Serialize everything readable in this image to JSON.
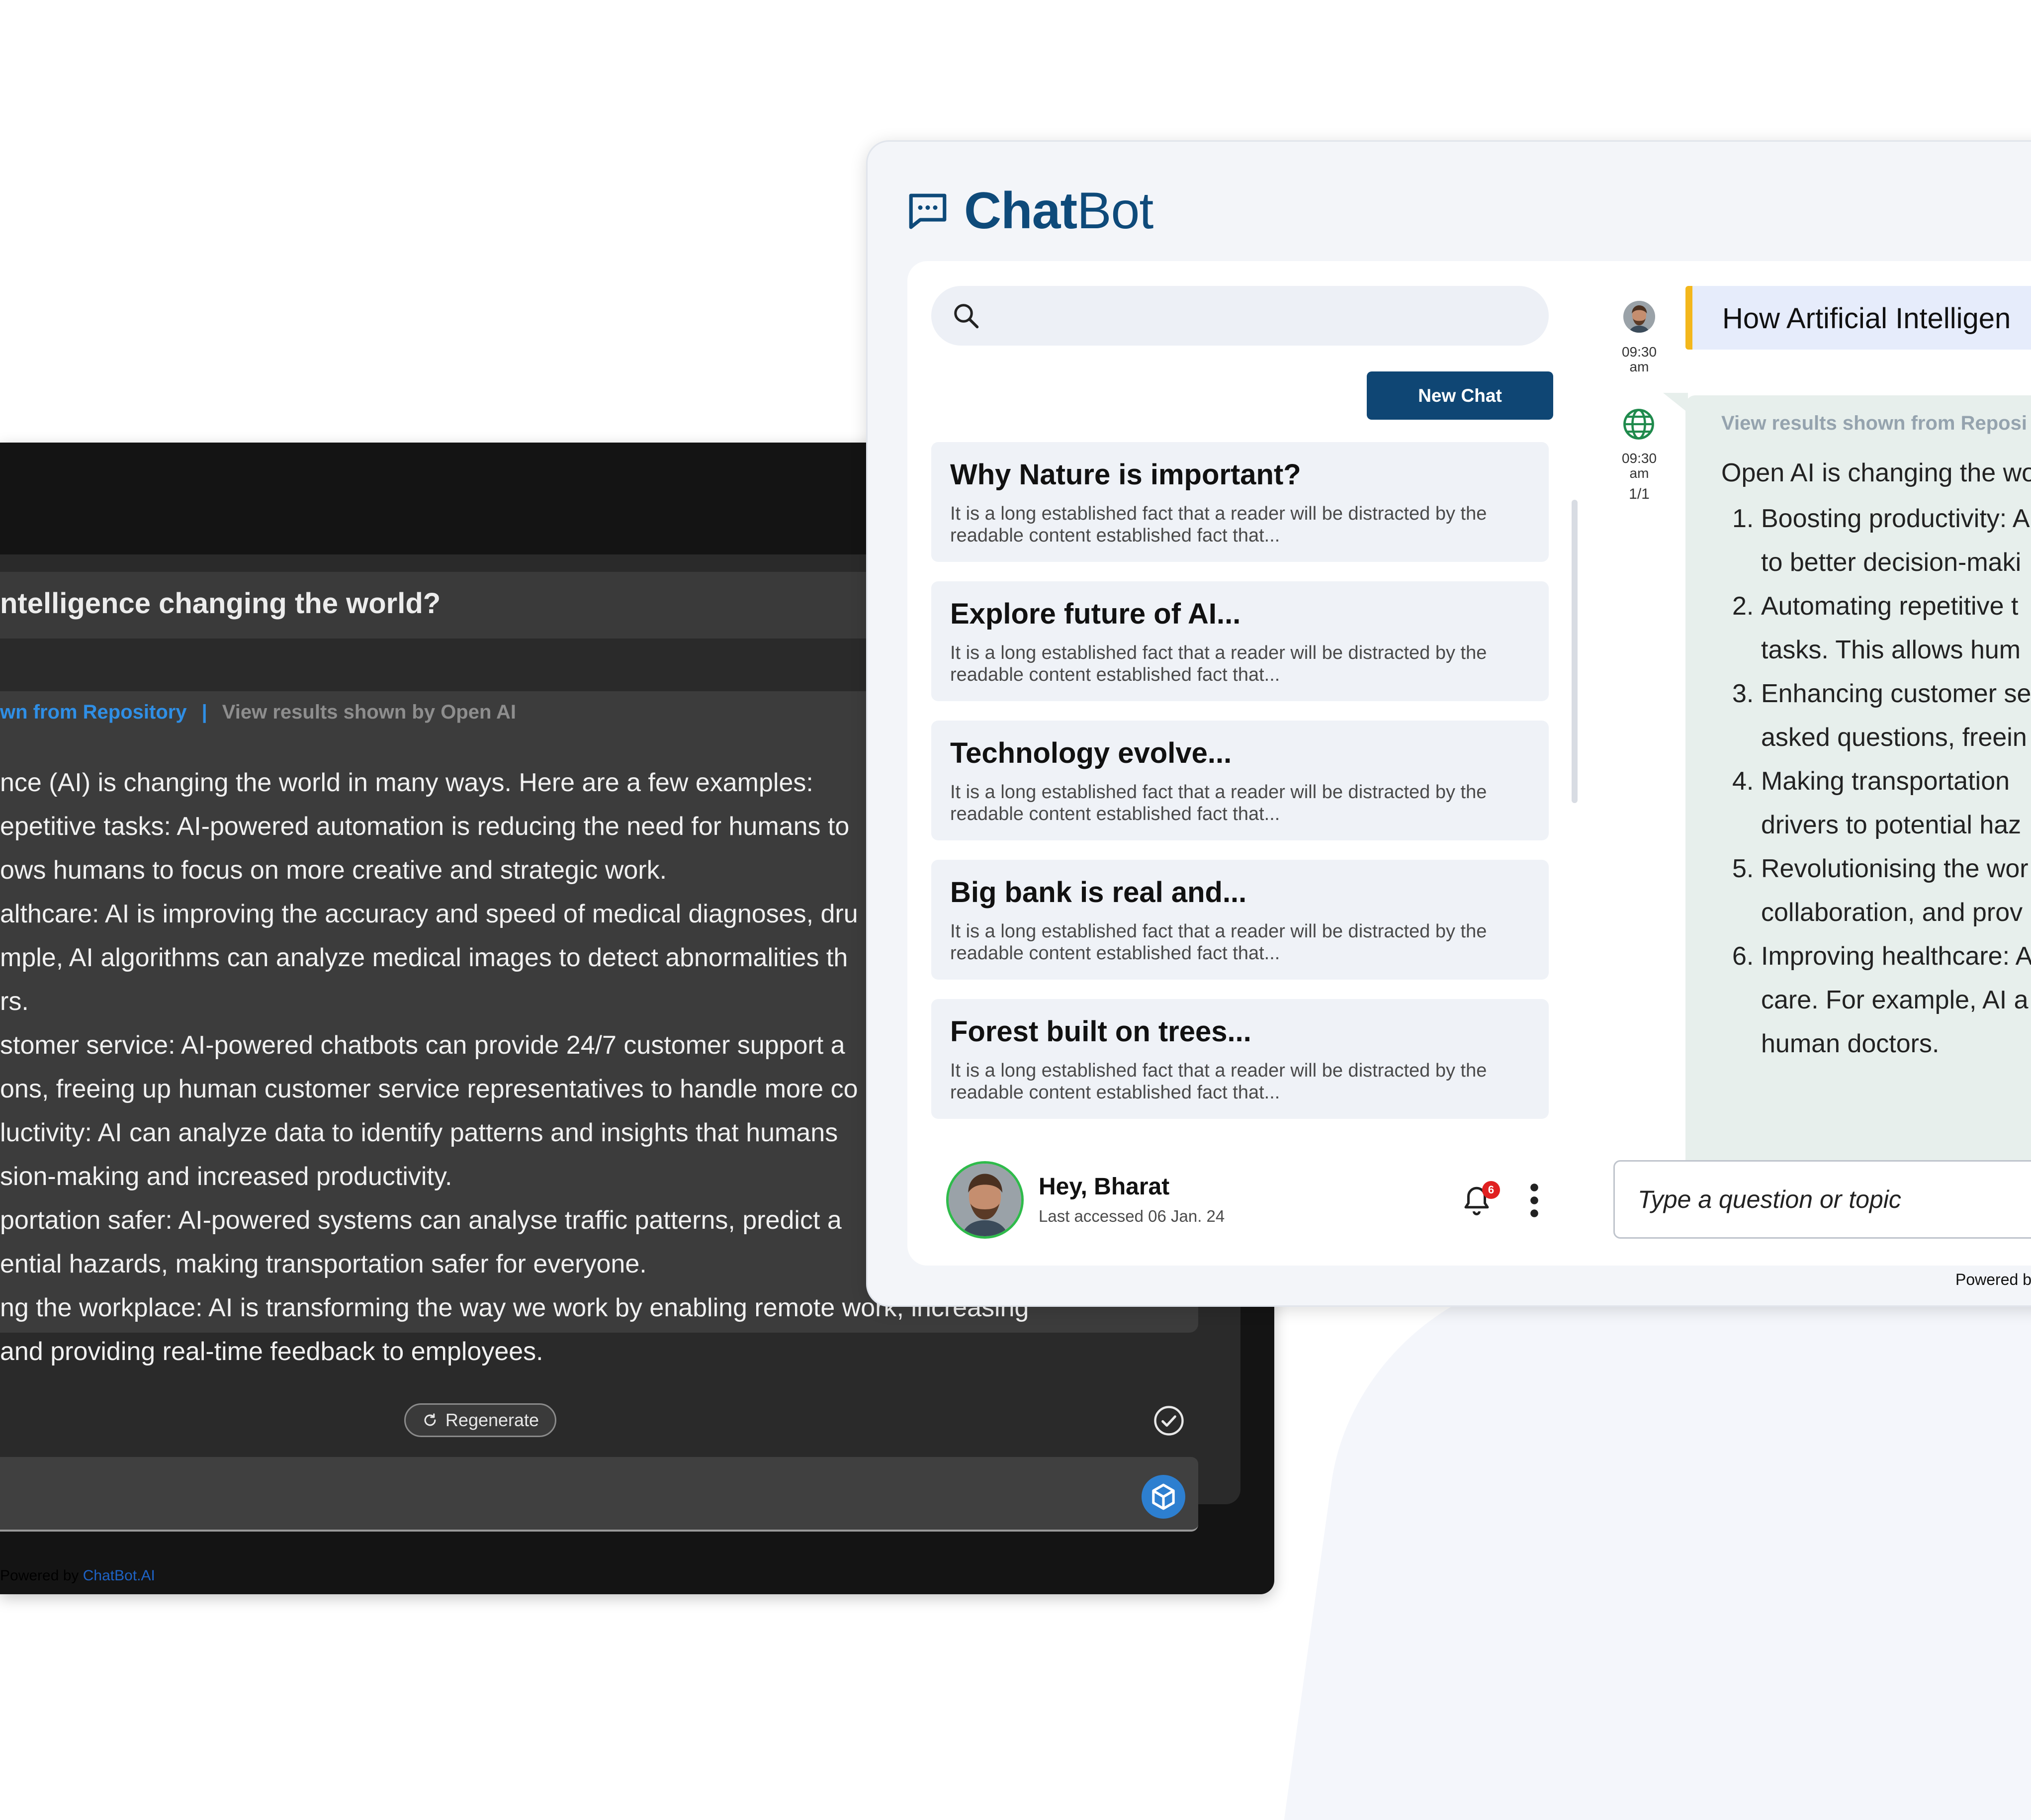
{
  "dark_window": {
    "question": "ntelligence changing the world?",
    "link_repository": "wn from Repository",
    "link_separator": "|",
    "link_openai": "View results shown by Open AI",
    "answer_lines": [
      "nce (AI) is changing the world in many ways. Here are a few examples:",
      "epetitive tasks: AI-powered automation is reducing the need for humans to",
      "ows humans to focus on more creative and strategic work.",
      "althcare: AI is improving the accuracy and speed of medical diagnoses, dru",
      "mple, AI algorithms can analyze medical images to detect abnormalities th",
      "rs.",
      "stomer service: AI-powered chatbots can provide 24/7 customer support a",
      "ons, freeing up human customer service representatives to handle more co",
      "luctivity: AI can analyze data to identify patterns and insights that humans",
      "sion-making and increased productivity.",
      "portation safer: AI-powered systems can analyse traffic patterns, predict a",
      "ential hazards, making transportation safer for everyone.",
      "ng the workplace: AI is transforming the way we work by enabling remote work, increasing",
      " and providing real-time feedback to employees."
    ],
    "regenerate_label": "Regenerate",
    "footer_prefix": "Powered by ",
    "footer_brand": "ChatBot.AI"
  },
  "light_window": {
    "brand_bold": "Chat",
    "brand_rest": "Bot",
    "search_placeholder": "",
    "new_chat_label": "New Chat",
    "chats": [
      {
        "title": "Why Nature is important?",
        "desc": "It is a long established fact that a reader will be distracted by the readable content established fact that..."
      },
      {
        "title": "Explore future of AI...",
        "desc": "It is a long established fact that a reader will be distracted by the readable content established fact that..."
      },
      {
        "title": "Technology evolve...",
        "desc": "It is a long established fact that a reader will be distracted by the readable content established fact that..."
      },
      {
        "title": "Big bank is real and...",
        "desc": "It is a long established fact that a reader will be distracted by the readable content established fact that..."
      },
      {
        "title": "Forest built on trees...",
        "desc": "It is a long established fact that a reader will be distracted by the readable content established fact that..."
      }
    ],
    "user": {
      "greeting": "Hey, Bharat",
      "last_accessed": "Last accessed 06 Jan. 24",
      "notification_count": "6"
    },
    "messages": {
      "user_time": "09:30",
      "user_ampm": "am",
      "bot_time": "09:30",
      "bot_ampm": "am",
      "bot_page": "1/1",
      "question": "How Artificial Intelligen",
      "repo_link": "View results shown from Reposi",
      "intro": "Open AI is changing the wo",
      "items": [
        {
          "num": "1.",
          "lines": [
            "Boosting productivity: A",
            "to better decision-maki"
          ]
        },
        {
          "num": "2.",
          "lines": [
            "Automating repetitive t",
            "tasks. This allows hum"
          ]
        },
        {
          "num": "3.",
          "lines": [
            "Enhancing customer se",
            "asked questions, freein"
          ]
        },
        {
          "num": "4.",
          "lines": [
            "Making transportation",
            "drivers to potential haz"
          ]
        },
        {
          "num": "5.",
          "lines": [
            "Revolutionising the wor",
            "collaboration, and prov"
          ]
        },
        {
          "num": "6.",
          "lines": [
            "Improving healthcare: A",
            "care. For example, AI a",
            "human doctors."
          ]
        }
      ]
    },
    "input_placeholder": "Type a question or topic",
    "powered_by": "Powered by"
  },
  "colors": {
    "brand": "#0e4a7a",
    "button": "#0f4674",
    "accent_bar": "#f3b71c",
    "dark_link": "#2f8fe6",
    "answer_bg": "#e7efec",
    "notification": "#e02020",
    "avatar_ring": "#2fbb4b"
  },
  "icons": [
    "chat-icon",
    "search-icon",
    "bell-icon",
    "kebab-icon",
    "globe-icon",
    "refresh-icon",
    "check-circle-icon",
    "cube-send-icon"
  ]
}
